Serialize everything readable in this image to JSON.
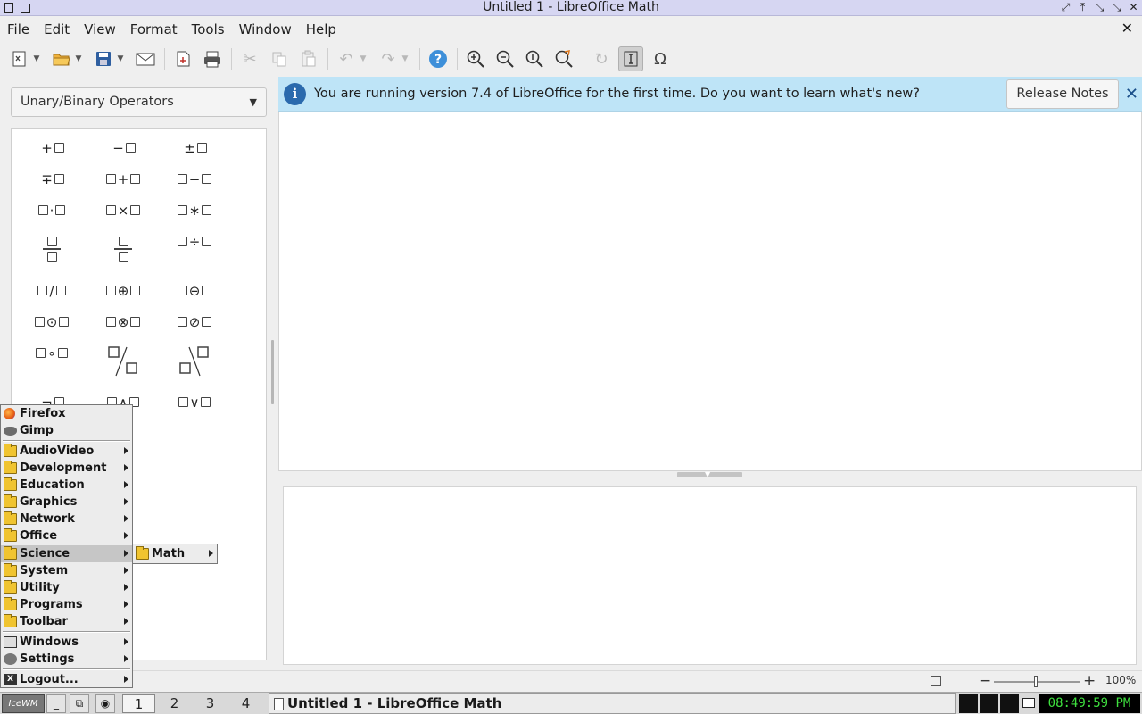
{
  "window": {
    "title": "Untitled 1 - LibreOffice Math"
  },
  "menubar": [
    "File",
    "Edit",
    "View",
    "Format",
    "Tools",
    "Window",
    "Help"
  ],
  "toolbar": {
    "icons": [
      "new-document-icon",
      "open-folder-icon",
      "save-icon",
      "email-icon",
      "export-pdf-icon",
      "print-icon",
      "cut-icon",
      "copy-icon",
      "paste-icon",
      "undo-icon",
      "redo-icon",
      "help-icon",
      "zoom-in-icon",
      "zoom-out-icon",
      "zoom-100-icon",
      "show-all-icon",
      "update-icon",
      "formula-cursor-icon",
      "symbols-icon"
    ]
  },
  "elements_panel": {
    "category": "Unary/Binary Operators",
    "items": [
      {
        "pre": "+",
        "a": true,
        "op": "",
        "b": false
      },
      {
        "pre": "−",
        "a": true,
        "op": "",
        "b": false
      },
      {
        "pre": "±",
        "a": true,
        "op": "",
        "b": false
      },
      {
        "pre": "∓",
        "a": true,
        "op": "",
        "b": false
      },
      {
        "pre": "",
        "a": true,
        "op": "+",
        "b": true
      },
      {
        "pre": "",
        "a": true,
        "op": "−",
        "b": true
      },
      {
        "pre": "",
        "a": true,
        "op": "·",
        "b": true
      },
      {
        "pre": "",
        "a": true,
        "op": "×",
        "b": true
      },
      {
        "pre": "",
        "a": true,
        "op": "∗",
        "b": true
      },
      {
        "pre": "",
        "a": true,
        "op": "÷",
        "b": true
      },
      {
        "pre": "",
        "a": true,
        "op": "/",
        "b": true
      },
      {
        "pre": "",
        "a": true,
        "op": "⊕",
        "b": true
      },
      {
        "pre": "",
        "a": true,
        "op": "⊖",
        "b": true
      },
      {
        "pre": "",
        "a": true,
        "op": "⊙",
        "b": true
      },
      {
        "pre": "",
        "a": true,
        "op": "⊗",
        "b": true
      },
      {
        "pre": "",
        "a": true,
        "op": "⊘",
        "b": true
      },
      {
        "pre": "",
        "a": true,
        "op": "∘",
        "b": true
      },
      {
        "pre": "",
        "a": true,
        "op": "∨",
        "b": true
      }
    ],
    "partial_row": [
      "¬",
      "∧"
    ]
  },
  "infobar": {
    "message": "You are running version 7.4 of LibreOffice for the first time. Do you want to learn what's new?",
    "button": "Release Notes",
    "close": "✕"
  },
  "statusbar": {
    "zoom_percent": 100,
    "zoom_label": "100%"
  },
  "start_menu": {
    "items": [
      {
        "label": "Firefox",
        "icon": "firefox-icon",
        "submenu": false
      },
      {
        "label": "Gimp",
        "icon": "gimp-icon",
        "submenu": false
      },
      {
        "label": "AudioVideo",
        "icon": "folder-icon",
        "submenu": true
      },
      {
        "label": "Development",
        "icon": "folder-icon",
        "submenu": true
      },
      {
        "label": "Education",
        "icon": "folder-icon",
        "submenu": true
      },
      {
        "label": "Graphics",
        "icon": "folder-icon",
        "submenu": true
      },
      {
        "label": "Network",
        "icon": "folder-icon",
        "submenu": true
      },
      {
        "label": "Office",
        "icon": "folder-icon",
        "submenu": true
      },
      {
        "label": "Science",
        "icon": "folder-icon",
        "submenu": true,
        "highlighted": true
      },
      {
        "label": "System",
        "icon": "folder-icon",
        "submenu": true
      },
      {
        "label": "Utility",
        "icon": "folder-icon",
        "submenu": true
      },
      {
        "label": "Programs",
        "icon": "folder-icon",
        "submenu": true
      },
      {
        "label": "Toolbar",
        "icon": "folder-icon",
        "submenu": true
      },
      {
        "label": "Windows",
        "icon": "windows-icon",
        "submenu": true
      },
      {
        "label": "Settings",
        "icon": "settings-icon",
        "submenu": true
      },
      {
        "label": "Logout...",
        "icon": "logout-icon",
        "submenu": true
      }
    ],
    "submenu": {
      "parent": "Science",
      "items": [
        {
          "label": "Math",
          "icon": "folder-icon",
          "submenu": true
        }
      ]
    }
  },
  "taskbar": {
    "logo": "IceWM",
    "workspaces": [
      "1",
      "2",
      "3",
      "4"
    ],
    "active_workspace": "1",
    "task_label": "Untitled 1 - LibreOffice Math",
    "clock": "08:49:59 PM"
  },
  "colors": {
    "infobar_bg": "#bee4f7",
    "info_icon": "#2b6aad",
    "titlebar_bg": "#d6d6f2",
    "clock_fg": "#3fe03f",
    "folder": "#f0c430"
  }
}
